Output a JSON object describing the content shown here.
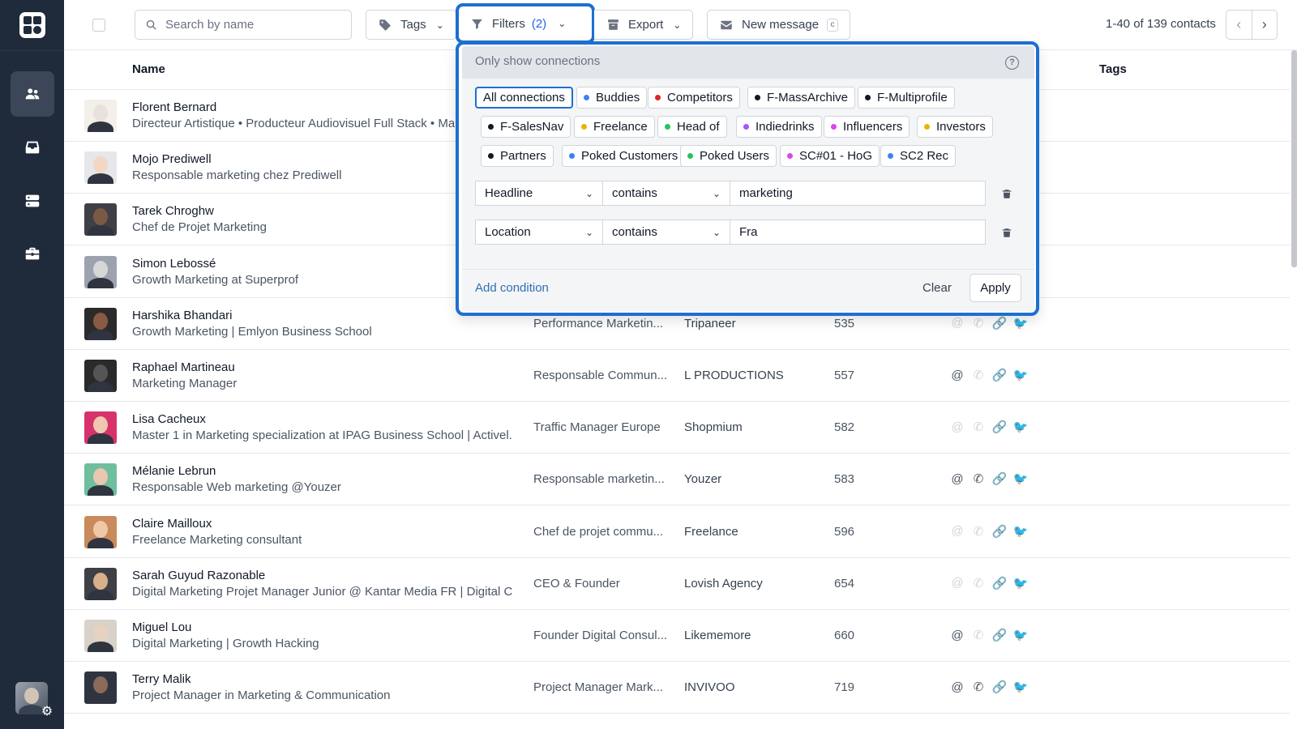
{
  "toolbar": {
    "search_placeholder": "Search by name",
    "tags_label": "Tags",
    "filters_label": "Filters",
    "filters_count": "(2)",
    "export_label": "Export",
    "new_message_label": "New message",
    "new_message_shortcut": "c",
    "pager_text": "1-40 of 139 contacts"
  },
  "table": {
    "col_name": "Name",
    "col_tags": "Tags"
  },
  "contacts": [
    {
      "name": "Florent Bernard",
      "headline": "Directeur Artistique • Producteur Audiovisuel Full Stack • Ma",
      "position": "",
      "company": "",
      "number": ""
    },
    {
      "name": "Mojo Prediwell",
      "headline": "Responsable marketing chez Prediwell",
      "position": "",
      "company": "",
      "number": ""
    },
    {
      "name": "Tarek Chroghw",
      "headline": "Chef de Projet Marketing",
      "position": "",
      "company": "",
      "number": ""
    },
    {
      "name": "Simon Lebossé",
      "headline": "Growth Marketing at Superprof",
      "position": "",
      "company": "",
      "number": ""
    },
    {
      "name": "Harshika Bhandari",
      "headline": "Growth Marketing | Emlyon Business School",
      "position": "Performance Marketin...",
      "company": "Tripaneer",
      "number": "535"
    },
    {
      "name": "Raphael Martineau",
      "headline": "Marketing Manager",
      "position": "Responsable Commun...",
      "company": "L PRODUCTIONS",
      "number": "557"
    },
    {
      "name": "Lisa Cacheux",
      "headline": "Master 1 in Marketing specialization at IPAG Business School | Activel...",
      "position": "Traffic Manager Europe",
      "company": "Shopmium",
      "number": "582"
    },
    {
      "name": "Mélanie Lebrun",
      "headline": "Responsable Web marketing @Youzer",
      "position": "Responsable marketin...",
      "company": "Youzer",
      "number": "583"
    },
    {
      "name": "Claire Mailloux",
      "headline": "Freelance Marketing consultant",
      "position": "Chef de projet commu...",
      "company": "Freelance",
      "number": "596"
    },
    {
      "name": "Sarah Guyud Razonable",
      "headline": "Digital Marketing Projet Manager Junior @ Kantar Media FR | Digital C...",
      "position": "CEO & Founder",
      "company": "Lovish Agency",
      "number": "654"
    },
    {
      "name": "Miguel Lou",
      "headline": "Digital Marketing | Growth Hacking",
      "position": "Founder Digital Consul...",
      "company": "Likememore",
      "number": "660"
    },
    {
      "name": "Terry Malik",
      "headline": "Project Manager in Marketing & Communication",
      "position": "Project Manager Mark...",
      "company": "INVIVOO",
      "number": "719"
    }
  ],
  "filters_popup": {
    "header": "Only show connections",
    "tags": [
      {
        "label": "All connections",
        "color": ""
      },
      {
        "label": "Buddies",
        "color": "#3b82f6"
      },
      {
        "label": "Competitors",
        "color": "#dc2626"
      },
      {
        "label": "F-MassArchive",
        "color": "#111827"
      },
      {
        "label": "F-Multiprofile",
        "color": "#111827"
      },
      {
        "label": "F-SalesNav",
        "color": "#111827"
      },
      {
        "label": "Freelance",
        "color": "#eab308"
      },
      {
        "label": "Head of",
        "color": "#22c55e"
      },
      {
        "label": "Indiedrinks",
        "color": "#a855f7"
      },
      {
        "label": "Influencers",
        "color": "#d946ef"
      },
      {
        "label": "Investors",
        "color": "#eab308"
      },
      {
        "label": "Partners",
        "color": "#111827"
      },
      {
        "label": "Poked Customers",
        "color": "#3b82f6"
      },
      {
        "label": "Poked Users",
        "color": "#22c55e"
      },
      {
        "label": "SC#01 - HoG",
        "color": "#d946ef"
      },
      {
        "label": "SC2 Rec",
        "color": "#3b82f6"
      }
    ],
    "conditions": [
      {
        "field": "Headline",
        "operator": "contains",
        "value": "marketing"
      },
      {
        "field": "Location",
        "operator": "contains",
        "value": "Fra"
      }
    ],
    "add_condition": "Add condition",
    "clear": "Clear",
    "apply": "Apply"
  }
}
